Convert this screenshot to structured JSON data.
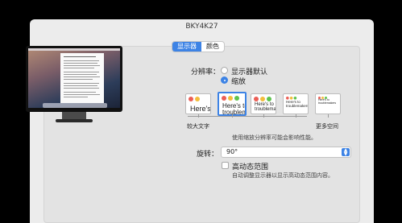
{
  "window": {
    "title": "BKY4K27"
  },
  "tabs": [
    {
      "label": "显示器",
      "active": true
    },
    {
      "label": "颜色",
      "active": false
    }
  ],
  "resolution": {
    "label": "分辨率：",
    "options": [
      {
        "label": "显示器默认",
        "selected": false
      },
      {
        "label": "缩放",
        "selected": true
      }
    ]
  },
  "scaling": {
    "thumb_text": "Here's to troublemakers",
    "thumb_label_1": "Here's",
    "thumb_label_2": "Here's to troublem",
    "thumb_label_3": "Here's to troublemake",
    "left_label": "较大文字",
    "right_label": "更多空间",
    "hint": "使用缩放分辨率可能会影响性能。"
  },
  "rotation": {
    "label": "旋转：",
    "value": "90°"
  },
  "hdr": {
    "label": "高动态范围",
    "checked": false,
    "hint": "自动调整显示器以显示高动态范围内容。"
  },
  "colors": {
    "accent": "#3d83e5",
    "red": "#ec5e55",
    "yellow": "#f3bd3c",
    "green": "#5ec34e"
  }
}
